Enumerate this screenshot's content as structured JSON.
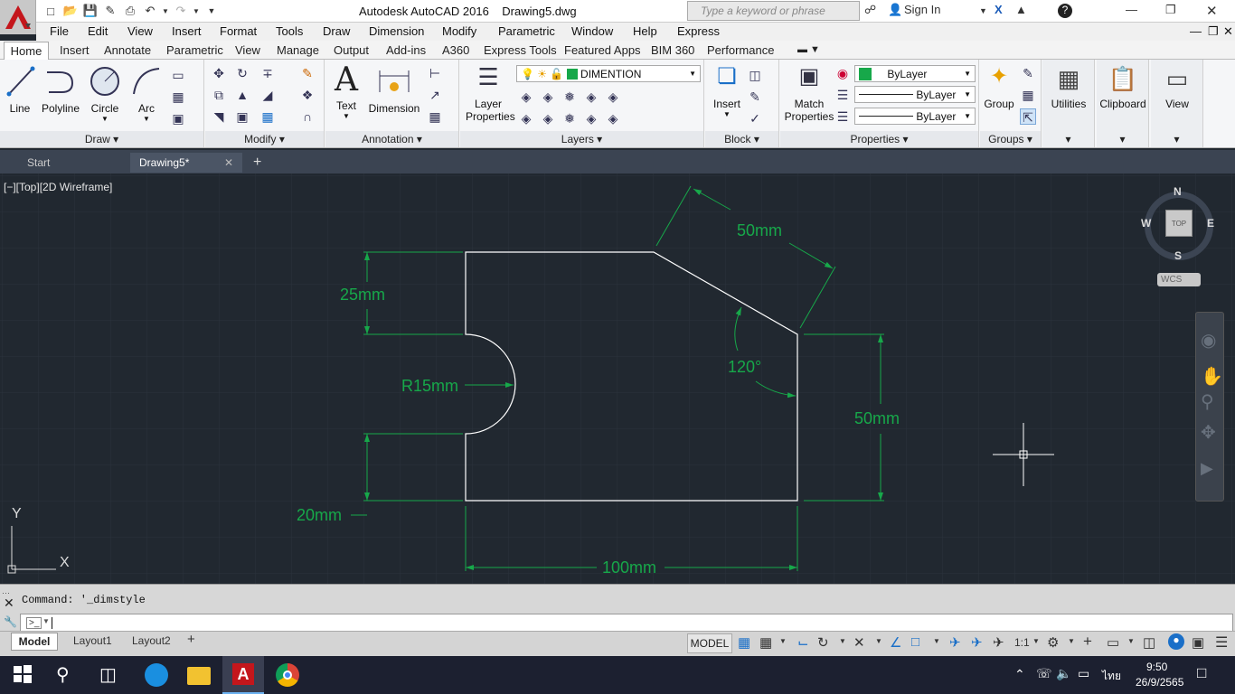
{
  "app": {
    "title": "Autodesk AutoCAD 2016",
    "document": "Drawing5.dwg",
    "logo_letter": "A"
  },
  "search": {
    "placeholder": "Type a keyword or phrase"
  },
  "account": {
    "signin": "Sign In"
  },
  "menus": [
    "File",
    "Edit",
    "View",
    "Insert",
    "Format",
    "Tools",
    "Draw",
    "Dimension",
    "Modify",
    "Parametric",
    "Window",
    "Help",
    "Express"
  ],
  "ribbon_tabs": [
    "Home",
    "Insert",
    "Annotate",
    "Parametric",
    "View",
    "Manage",
    "Output",
    "Add-ins",
    "A360",
    "Express Tools",
    "Featured Apps",
    "BIM 360",
    "Performance"
  ],
  "ribbon": {
    "draw": {
      "title": "Draw",
      "line": "Line",
      "polyline": "Polyline",
      "circle": "Circle",
      "arc": "Arc"
    },
    "modify": {
      "title": "Modify"
    },
    "annotation": {
      "title": "Annotation",
      "text": "Text",
      "dimension": "Dimension"
    },
    "layers": {
      "title": "Layers",
      "layer_properties": "Layer\nProperties",
      "current_layer": "DIMENTION"
    },
    "block": {
      "title": "Block",
      "insert": "Insert"
    },
    "properties": {
      "title": "Properties",
      "match": "Match\nProperties",
      "color": "ByLayer",
      "linetype": "ByLayer",
      "lineweight": "ByLayer"
    },
    "groups": {
      "title": "Groups",
      "group": "Group"
    },
    "utilities": "Utilities",
    "clipboard": "Clipboard",
    "view": "View"
  },
  "file_tabs": {
    "start": "Start",
    "drawing": "Drawing5*"
  },
  "viewport": {
    "label": "[−][Top][2D Wireframe]"
  },
  "viewcube": {
    "n": "N",
    "s": "S",
    "e": "E",
    "w": "W",
    "top": "TOP",
    "wcs": "WCS"
  },
  "ucs": {
    "x": "X",
    "y": "Y"
  },
  "dimensions": {
    "top_h": "25mm",
    "radius": "R15mm",
    "bottom_h": "20mm",
    "slant": "50mm",
    "angle": "120°",
    "right_h": "50mm",
    "width": "100mm"
  },
  "command": {
    "history": "Command:  '_dimstyle",
    "prompt": ""
  },
  "layout_tabs": [
    "Model",
    "Layout1",
    "Layout2"
  ],
  "status": {
    "model": "MODEL",
    "scale": "1:1"
  },
  "clock": {
    "time": "9:50",
    "date": "26/9/2565",
    "lang": "ไทย"
  },
  "colors": {
    "accent": "#0a8ff0",
    "dim": "#17a84a",
    "geom": "#ffffff",
    "canvas": "#212830"
  }
}
